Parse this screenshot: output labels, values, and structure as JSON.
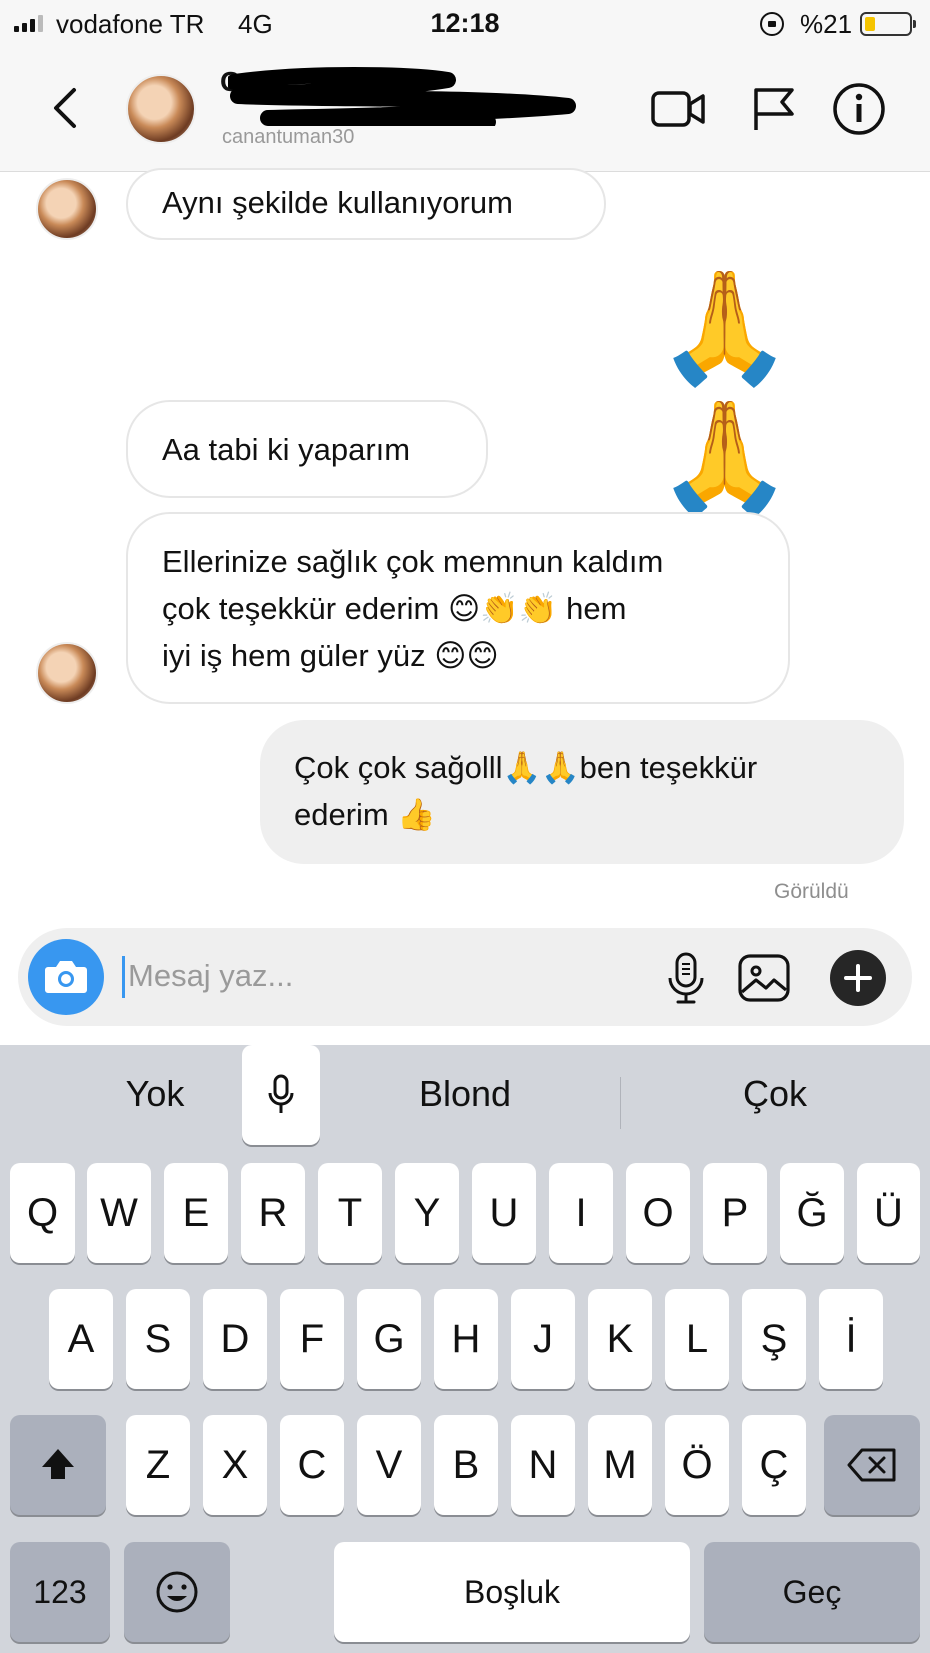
{
  "status": {
    "carrier": "vodafone TR",
    "network": "4G",
    "time": "12:18",
    "battery": "%21"
  },
  "header": {
    "name": "C",
    "handle": "canantuman30"
  },
  "messages": [
    {
      "from": "them",
      "text": "Aynı şekilde kullanıyorum"
    },
    {
      "from": "me",
      "emoji": "🙏🙏"
    },
    {
      "from": "them",
      "text": "Aa tabi ki yaparım"
    },
    {
      "from": "them",
      "line1": "Ellerinize sağlık çok memnun kaldım",
      "line2": "çok teşekkür ederim 😊👏👏 hem",
      "line3": "iyi iş hem güler yüz 😊😊"
    },
    {
      "from": "me",
      "line1": "Çok çok sağolll🙏🙏ben teşekkür",
      "line2": "ederim 👍"
    }
  ],
  "seen_label": "Görüldü",
  "composer": {
    "placeholder": "Mesaj yaz..."
  },
  "keyboard": {
    "suggestions": [
      "Yok",
      "Blond",
      "Çok"
    ],
    "row1": [
      "Q",
      "W",
      "E",
      "R",
      "T",
      "Y",
      "U",
      "I",
      "O",
      "P",
      "Ğ",
      "Ü"
    ],
    "row2": [
      "A",
      "S",
      "D",
      "F",
      "G",
      "H",
      "J",
      "K",
      "L",
      "Ş",
      "İ"
    ],
    "row3": [
      "Z",
      "X",
      "C",
      "V",
      "B",
      "N",
      "M",
      "Ö",
      "Ç"
    ],
    "numbers_key": "123",
    "space_key": "Boşluk",
    "return_key": "Geç"
  },
  "colors": {
    "accent": "#3897f0",
    "keyboard_bg": "#d2d5db",
    "bubble_out": "#efefef"
  }
}
